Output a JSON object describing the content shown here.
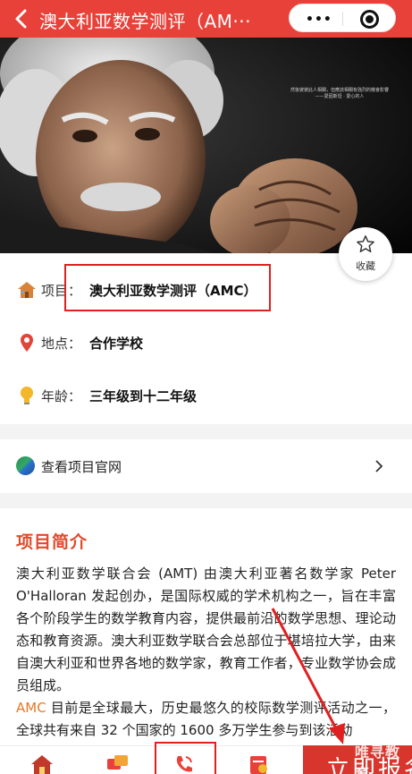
{
  "header": {
    "title": "澳大利亚数学测评（AM···",
    "more_label": "•••"
  },
  "hero": {
    "caption": "然後彼彼此人相關，但應該相關有強烈的機會影響 ——愛因斯坦 · 愛心的人"
  },
  "favorite": {
    "label": "收藏"
  },
  "info": {
    "project_label": "项目：",
    "project_value": "澳大利亚数学测评（AMC）",
    "location_label": "地点：",
    "location_value": "合作学校",
    "age_label": "年龄：",
    "age_value": "三年级到十二年级"
  },
  "website_link": {
    "label": "查看项目官网"
  },
  "intro": {
    "title": "项目简介",
    "paragraph1": "澳大利亚数学联合会 (AMT) 由澳大利亚著名数学家 Peter O'Halloran 发起创办，是国际权威的学术机构之一，旨在丰富各个阶段学生的数学教育内容，提供最前沿的数学思想、理论动态和教育资源。澳大利亚数学联合会总部位于堪培拉大学，由来自澳大利亚和世界各地的数学家，教育工作者，专业数学协会成员组成。",
    "highlight": "AMC",
    "paragraph2": " 目前是全球最大，历史最悠久的校际数学测评活动之一，全球共有来自 32 个国家的 1600 多万学生参与到该活动"
  },
  "bottom_bar": {
    "icons": [
      "home-icon",
      "chat-icon",
      "phone-icon",
      "calendar-icon"
    ],
    "report_label": "立即报名",
    "watermark": "唯寻教育"
  },
  "colors": {
    "brand": "#e8413a",
    "highlight_box": "#e02020",
    "section_title": "#e04a2a",
    "amc_highlight": "#e47a2a"
  }
}
